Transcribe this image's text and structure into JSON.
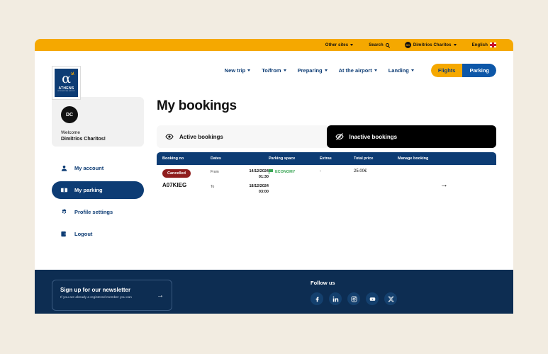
{
  "topbar": {
    "other_sites": "Other sites",
    "search": "Search",
    "user_initials": "DC",
    "user_name": "Dimitrios Charitos",
    "language": "English"
  },
  "logo": {
    "alpha": "α",
    "word": "ATHENS",
    "sub": "INTERNATIONAL AIRPORT"
  },
  "nav": {
    "items": [
      {
        "label": "New trip"
      },
      {
        "label": "To/from"
      },
      {
        "label": "Preparing"
      },
      {
        "label": "At the airport"
      },
      {
        "label": "Landing"
      }
    ],
    "toggle": {
      "flights": "Flights",
      "parking": "Parking"
    }
  },
  "sidebar": {
    "user": {
      "initials": "DC",
      "welcome": "Welcome",
      "name": "Dimitrios Charitos!"
    },
    "items": [
      {
        "label": "My account",
        "icon": "person-icon"
      },
      {
        "label": "My parking",
        "icon": "ticket-icon"
      },
      {
        "label": "Profile settings",
        "icon": "gear-icon"
      },
      {
        "label": "Logout",
        "icon": "logout-icon"
      }
    ]
  },
  "main": {
    "title": "My bookings",
    "tabs": [
      {
        "label": "Active bookings",
        "icon": "eye-icon",
        "active": false
      },
      {
        "label": "Inactive bookings",
        "icon": "eye-slash-icon",
        "active": true
      }
    ],
    "table": {
      "headers": {
        "booking_no": "Booking no",
        "dates": "Dates",
        "parking_space": "Parking space",
        "extras": "Extras",
        "total_price": "Total price",
        "manage_booking": "Manage booking"
      },
      "rows": [
        {
          "status": "Cancelled",
          "booking_no": "A07KIEG",
          "from_label": "From",
          "from_date": "14/12/2024",
          "from_time": "01:30",
          "to_label": "To",
          "to_date": "18/12/2024",
          "to_time": "03:00",
          "parking_space": "ECONOMY",
          "extras": "-",
          "total_price": "25.00€"
        }
      ]
    }
  },
  "footer": {
    "newsletter": {
      "title": "Sign up for our newsletter",
      "subtitle": "If you are already a registered member you can"
    },
    "follow": {
      "title": "Follow us",
      "socials": [
        {
          "name": "facebook-icon"
        },
        {
          "name": "linkedin-icon"
        },
        {
          "name": "instagram-icon"
        },
        {
          "name": "youtube-icon"
        },
        {
          "name": "x-icon"
        }
      ]
    }
  },
  "colors": {
    "brand_blue": "#0d3c74",
    "accent_yellow": "#f5a800",
    "parking_blue": "#0d57a8",
    "cancelled_red": "#8f1d1d",
    "economy_green": "#3aa655",
    "footer_navy": "#0d2d52",
    "page_bg": "#f2ece1"
  }
}
